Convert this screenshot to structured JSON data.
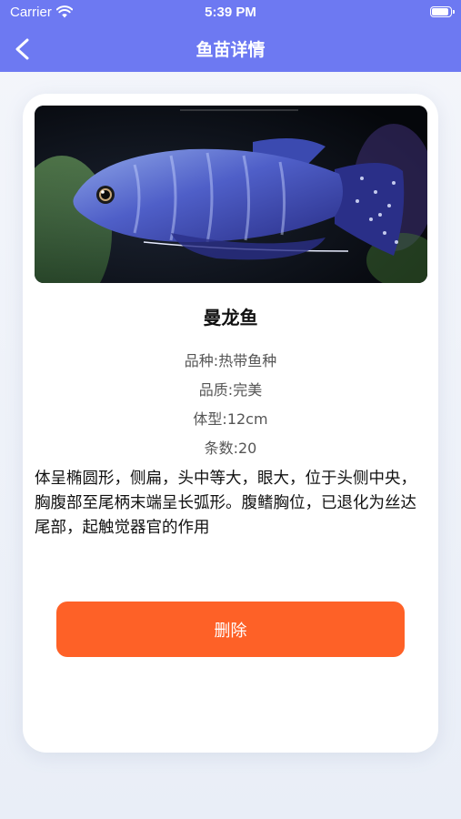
{
  "status_bar": {
    "carrier": "Carrier",
    "time": "5:39 PM",
    "battery_level": 0.95
  },
  "nav": {
    "title": "鱼苗详情"
  },
  "fish": {
    "name": "曼龙鱼",
    "variety": "品种:热带鱼种",
    "quality": "品质:完美",
    "body_size": "体型:12cm",
    "count": "条数:20",
    "description": "体呈椭圆形，侧扁，头中等大，眼大，位于头侧中央，胸腹部至尾柄末端呈长弧形。腹鳍胸位，已退化为丝达尾部，起触觉器官的作用"
  },
  "actions": {
    "delete_label": "删除"
  },
  "colors": {
    "nav_bg": "#6d79f2",
    "delete_bg": "#fe6127"
  },
  "icons": [
    "wifi-icon",
    "battery-icon",
    "back-chevron-icon"
  ]
}
